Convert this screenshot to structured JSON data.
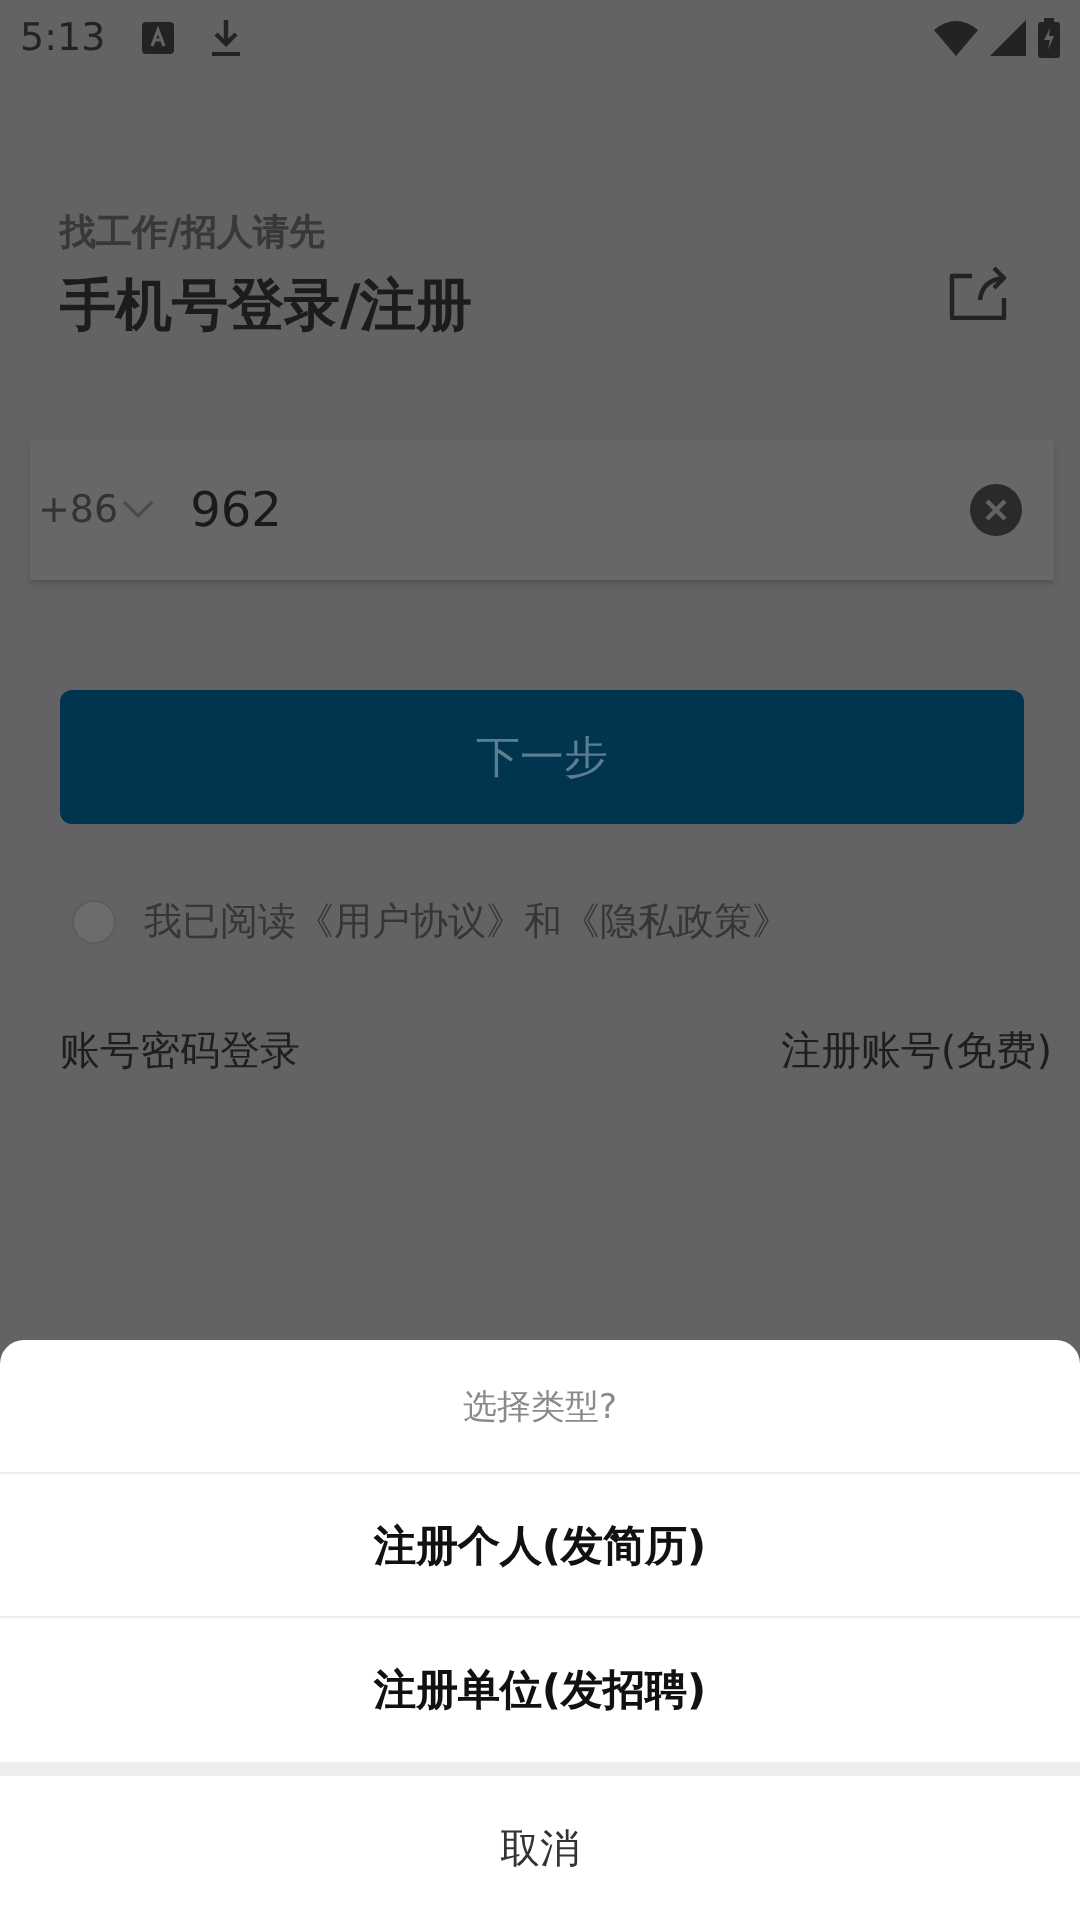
{
  "status_bar": {
    "time": "5:13"
  },
  "header": {
    "subtitle": "找工作/招人请先",
    "title": "手机号登录/注册"
  },
  "phone_field": {
    "country_code": "+86",
    "value": "962"
  },
  "next_button": {
    "label": "下一步"
  },
  "agreement": {
    "checked": false,
    "text": "我已阅读《用户协议》和《隐私政策》"
  },
  "links": [
    "账号密码登录",
    "注册账号(免费)"
  ],
  "sheet": {
    "title": "选择类型?",
    "options": [
      "注册个人(发简历)",
      "注册单位(发招聘)"
    ],
    "cancel": "取消"
  }
}
